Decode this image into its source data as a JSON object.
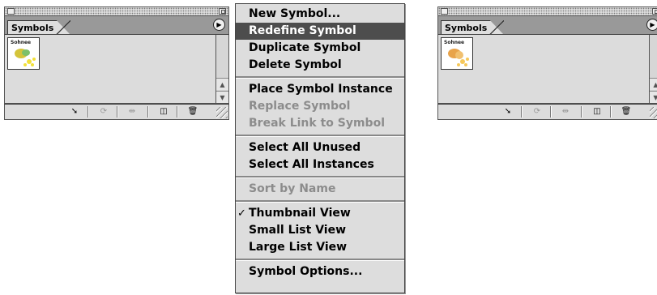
{
  "palette_left": {
    "tab_label": "Symbols",
    "thumbnail_label": "Sohnee"
  },
  "palette_right": {
    "tab_label": "Symbols",
    "thumbnail_label": "Sohnee"
  },
  "menu": {
    "items": [
      {
        "label": "New Symbol...",
        "enabled": true
      },
      {
        "label": "Redefine Symbol",
        "enabled": true,
        "selected": true
      },
      {
        "label": "Duplicate Symbol",
        "enabled": true
      },
      {
        "label": "Delete Symbol",
        "enabled": true
      },
      {
        "label": "Place Symbol Instance",
        "enabled": true
      },
      {
        "label": "Replace Symbol",
        "enabled": false
      },
      {
        "label": "Break Link to Symbol",
        "enabled": false
      },
      {
        "label": "Select All Unused",
        "enabled": true
      },
      {
        "label": "Select All Instances",
        "enabled": true
      },
      {
        "label": "Sort by Name",
        "enabled": false
      },
      {
        "label": "Thumbnail View",
        "enabled": true,
        "checked": true
      },
      {
        "label": "Small List View",
        "enabled": true
      },
      {
        "label": "Large List View",
        "enabled": true
      },
      {
        "label": "Symbol Options...",
        "enabled": true
      }
    ]
  },
  "icons": {
    "toolbar": [
      "place-symbol-icon",
      "replace-symbol-icon",
      "break-link-icon",
      "new-symbol-icon",
      "delete-symbol-icon"
    ],
    "palette_menu": "palette-menu-arrow-icon",
    "check": "checkmark-icon"
  },
  "colors": {
    "menu_background": "#dddddd",
    "menu_highlight": "#4d4d4d",
    "disabled_text": "#8c8c8c",
    "palette_background": "#dcdcdc",
    "tabrow_background": "#999999"
  }
}
